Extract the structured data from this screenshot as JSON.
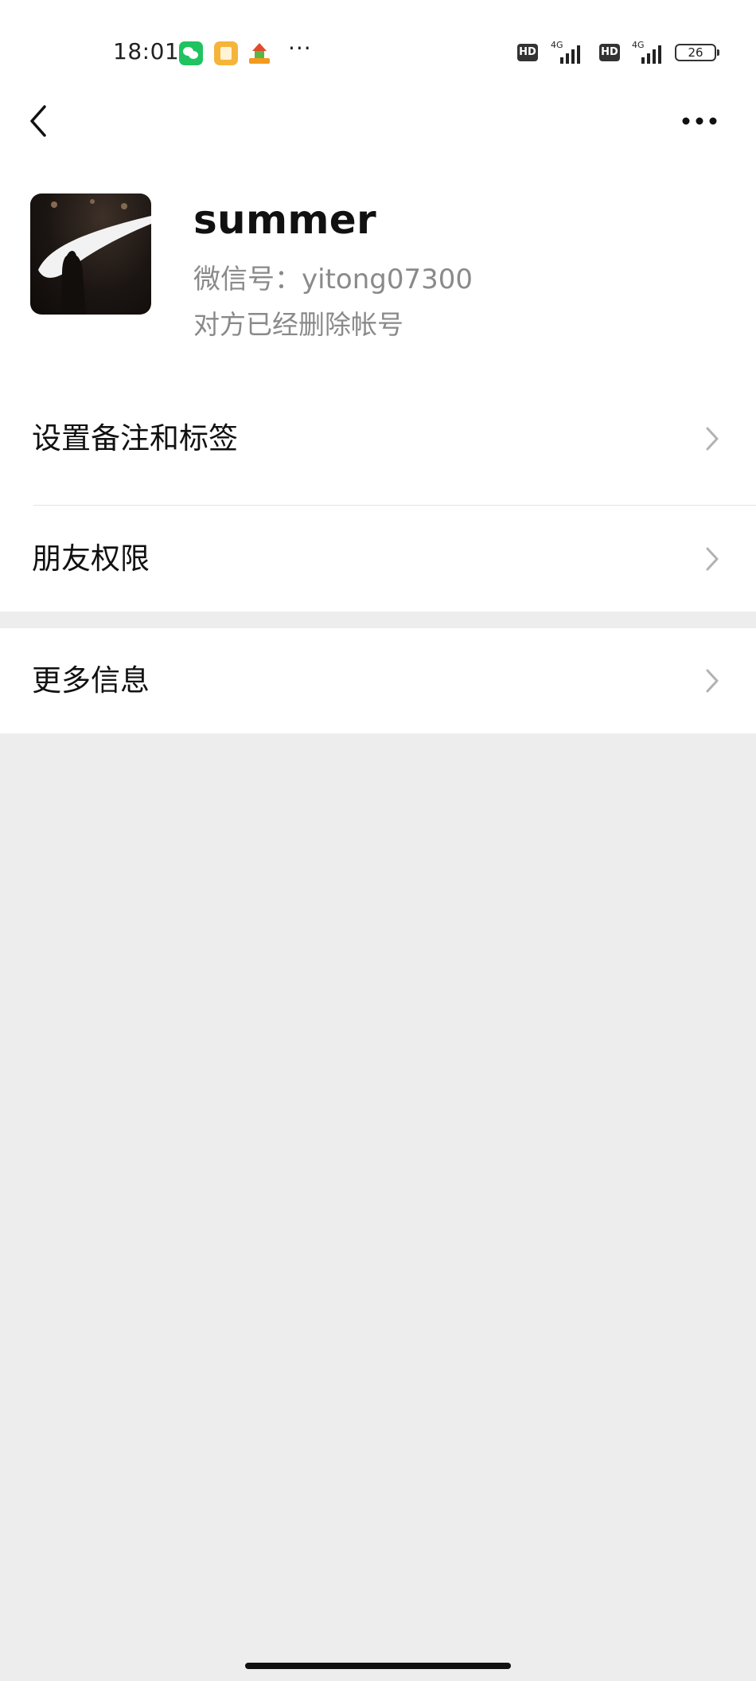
{
  "status_bar": {
    "time": "18:01",
    "app_icons": [
      "wechat-icon",
      "notes-icon",
      "taobao-icon"
    ],
    "more": "···",
    "hd_badges": [
      "HD",
      "HD"
    ],
    "network_types": [
      "4G",
      "4G"
    ],
    "battery": "26"
  },
  "nav": {
    "back_icon": "chevron-left-icon",
    "more_icon": "more-dots-icon"
  },
  "profile": {
    "name": "summer",
    "wechat_id_label": "微信号：",
    "wechat_id": "yitong07300",
    "status": "对方已经删除帐号"
  },
  "menu": {
    "group1": [
      {
        "label": "设置备注和标签"
      },
      {
        "label": "朋友权限"
      }
    ],
    "group2": [
      {
        "label": "更多信息"
      }
    ]
  },
  "colors": {
    "background": "#ededed",
    "card": "#ffffff",
    "secondary_text": "#8a8a8a",
    "wechat_green": "#1fc35f"
  }
}
